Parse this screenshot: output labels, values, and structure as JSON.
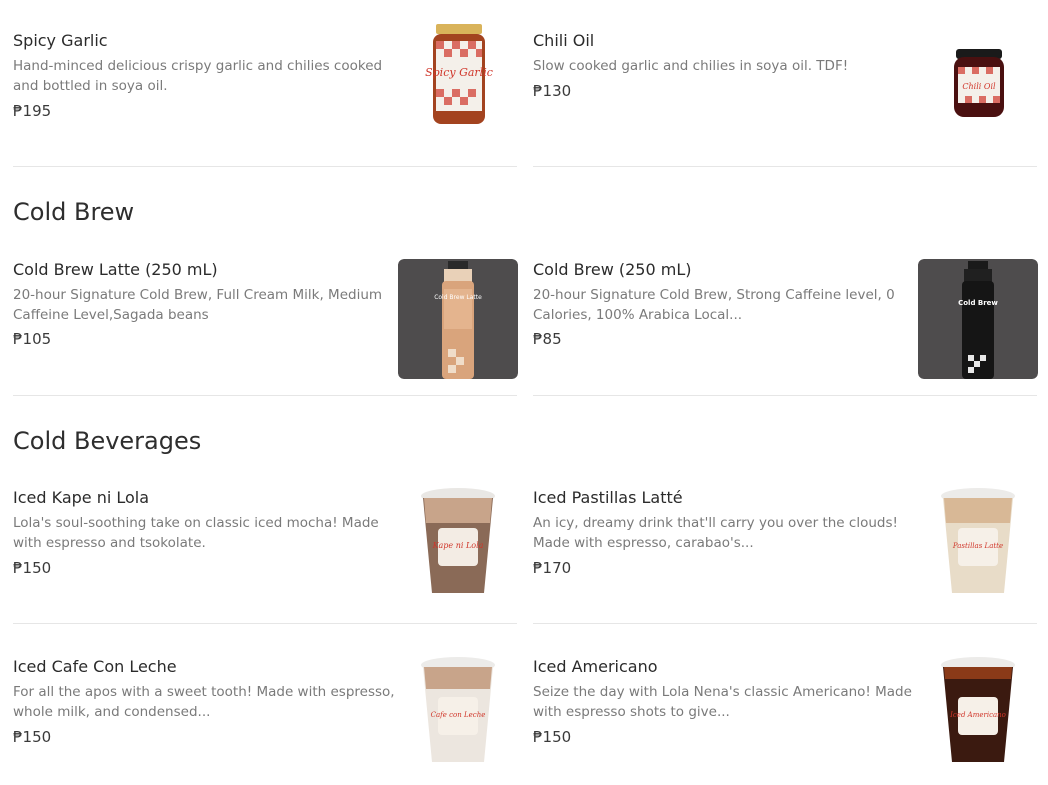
{
  "sections": [
    {
      "title": "",
      "items": [
        {
          "name": "Spicy Garlic",
          "desc": "Hand-minced delicious crispy garlic and chilies cooked and bottled in soya oil.",
          "price": "₱195"
        },
        {
          "name": "Chili Oil",
          "desc": "Slow cooked garlic and chilies in soya oil. TDF!",
          "price": "₱130"
        }
      ]
    },
    {
      "title": "Cold Brew",
      "items": [
        {
          "name": "Cold Brew Latte (250 mL)",
          "desc": "20-hour Signature Cold Brew, Full Cream Milk, Medium Caffeine Level,Sagada beans",
          "price": "₱105"
        },
        {
          "name": "Cold Brew (250 mL)",
          "desc": "20-hour Signature Cold Brew, Strong Caffeine level, 0 Calories, 100% Arabica Local...",
          "price": "₱85"
        }
      ]
    },
    {
      "title": "Cold Beverages",
      "items": [
        {
          "name": "Iced Kape ni Lola",
          "desc": "Lola's soul-soothing take on classic iced mocha! Made with espresso and tsokolate.",
          "price": "₱150"
        },
        {
          "name": "Iced Pastillas Latté",
          "desc": "An icy, dreamy drink that'll carry you over the clouds! Made with espresso, carabao's...",
          "price": "₱170"
        },
        {
          "name": "Iced Cafe Con Leche",
          "desc": "For all the apos with a sweet tooth! Made with espresso, whole milk, and condensed...",
          "price": "₱150"
        },
        {
          "name": "Iced Americano",
          "desc": "Seize the day with Lola Nena's classic Americano! Made with espresso shots to give...",
          "price": "₱150"
        }
      ]
    }
  ],
  "product_labels": {
    "spicy_garlic": "Spicy Garlic",
    "chili_oil": "Chili Oil",
    "cold_brew_latte": "Cold Brew Latte",
    "cold_brew": "Cold Brew",
    "kape_ni_lola": "Kape ni Lola",
    "pastillas_latte": "Pastillas Latte",
    "cafe_con_leche": "Cafe con Leche",
    "iced_americano": "Iced Americano"
  },
  "colors": {
    "divider": "#e6e6e6",
    "price": "#3a3a3a",
    "muted": "#7a7a7a",
    "label_red": "#d0362a"
  }
}
